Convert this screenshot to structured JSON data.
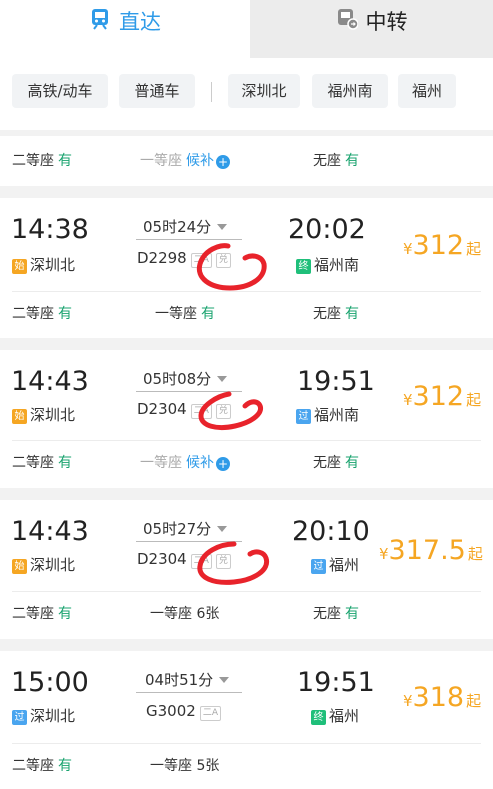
{
  "tabs": {
    "direct": "直达",
    "transfer": "中转"
  },
  "filters": [
    "高铁/动车",
    "普通车",
    "深圳北",
    "福州南",
    "福州"
  ],
  "top_row": [
    {
      "label": "二等座",
      "avail": "有"
    },
    {
      "label": "一等座",
      "wait": "候补",
      "dim": true
    },
    {
      "label": "无座",
      "avail": "有"
    }
  ],
  "trains": [
    {
      "depart": "14:38",
      "depart_tag": "始",
      "depart_station": "深圳北",
      "duration": "05时24分",
      "train_no": "D2298",
      "mini": "兑",
      "arrive": "20:02",
      "arrive_tag": "终",
      "arrive_station": "福州南",
      "price": "312",
      "price_suffix": "起",
      "currency": "¥",
      "seats": [
        {
          "label": "二等座",
          "avail": "有"
        },
        {
          "label": "一等座",
          "avail": "有"
        },
        {
          "label": "无座",
          "avail": "有"
        }
      ]
    },
    {
      "depart": "14:43",
      "depart_tag": "始",
      "depart_station": "深圳北",
      "duration": "05时08分",
      "train_no": "D2304",
      "mini": "兑",
      "arrive": "19:51",
      "arrive_tag": "过",
      "arrive_station": "福州南",
      "price": "312",
      "price_suffix": "起",
      "currency": "¥",
      "seats": [
        {
          "label": "二等座",
          "avail": "有"
        },
        {
          "label": "一等座",
          "wait": "候补"
        },
        {
          "label": "无座",
          "avail": "有"
        }
      ]
    },
    {
      "depart": "14:43",
      "depart_tag": "始",
      "depart_station": "深圳北",
      "duration": "05时27分",
      "train_no": "D2304",
      "mini": "兑",
      "arrive": "20:10",
      "arrive_tag": "过",
      "arrive_station": "福州",
      "price": "317.5",
      "price_suffix": "起",
      "currency": "¥",
      "seats": [
        {
          "label": "二等座",
          "avail": "有"
        },
        {
          "label": "一等座",
          "count": "6张"
        },
        {
          "label": "无座",
          "avail": "有"
        }
      ]
    },
    {
      "depart": "15:00",
      "depart_tag": "过",
      "depart_station": "深圳北",
      "duration": "04时51分",
      "train_no": "G3002",
      "mini": "",
      "arrive": "19:51",
      "arrive_tag": "终",
      "arrive_station": "福州",
      "price": "318",
      "price_suffix": "起",
      "currency": "¥",
      "seats": [
        {
          "label": "二等座",
          "avail": "有"
        },
        {
          "label": "一等座",
          "count": "5张"
        }
      ]
    }
  ],
  "colors": {
    "accent": "#2f9be8",
    "price": "#f5a623",
    "available": "#1aa36f",
    "annotation": "#e8232b"
  }
}
